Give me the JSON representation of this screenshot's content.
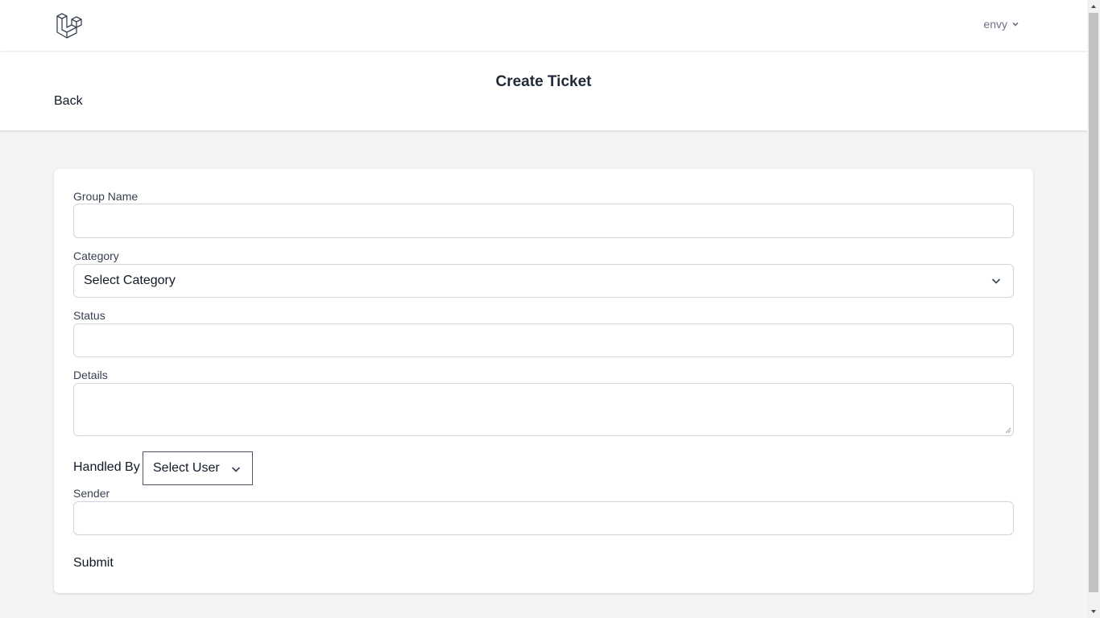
{
  "nav": {
    "user_name": "envy",
    "logo_icon": "laravel-logo-icon"
  },
  "header": {
    "title": "Create Ticket",
    "back_label": "Back"
  },
  "form": {
    "group_name": {
      "label": "Group Name",
      "value": ""
    },
    "category": {
      "label": "Category",
      "selected": "Select Category"
    },
    "status": {
      "label": "Status",
      "value": ""
    },
    "details": {
      "label": "Details",
      "value": ""
    },
    "handled_by": {
      "label": "Handled By",
      "selected": "Select User"
    },
    "sender": {
      "label": "Sender",
      "value": ""
    },
    "submit_label": "Submit"
  },
  "colors": {
    "page_bg": "#f3f4f6",
    "card_bg": "#ffffff",
    "border": "#d1d5db",
    "text": "#111827"
  }
}
